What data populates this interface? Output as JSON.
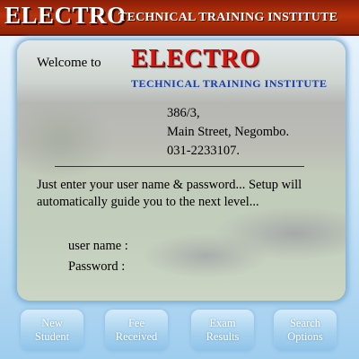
{
  "header": {
    "brand": "ELECTRO",
    "subtitle": "TECHNICAL TRAINING INSTITUTE"
  },
  "welcome": {
    "text": "Welcome to",
    "logo_main": "ELECTRO",
    "logo_sub": "TECHNICAL TRAINING INSTITUTE"
  },
  "address": {
    "line1": "386/3,",
    "line2": "Main Street, Negombo.",
    "phone": "031-2233107."
  },
  "instructions": {
    "text": "Just enter your user name & password... Setup will automatically guide you to the next level..."
  },
  "login": {
    "username_label": "user name :",
    "password_label": "Password :",
    "username_value": "",
    "password_value": ""
  },
  "buttons": [
    {
      "label": "New Student"
    },
    {
      "label": "Fee Received"
    },
    {
      "label": "Exam Results"
    },
    {
      "label": "Search Options"
    }
  ],
  "colors": {
    "header_bg": "#b8330c",
    "logo_red": "#d8140e",
    "logo_blue": "#1b3f9a",
    "button_blue": "#a8d2ee"
  }
}
